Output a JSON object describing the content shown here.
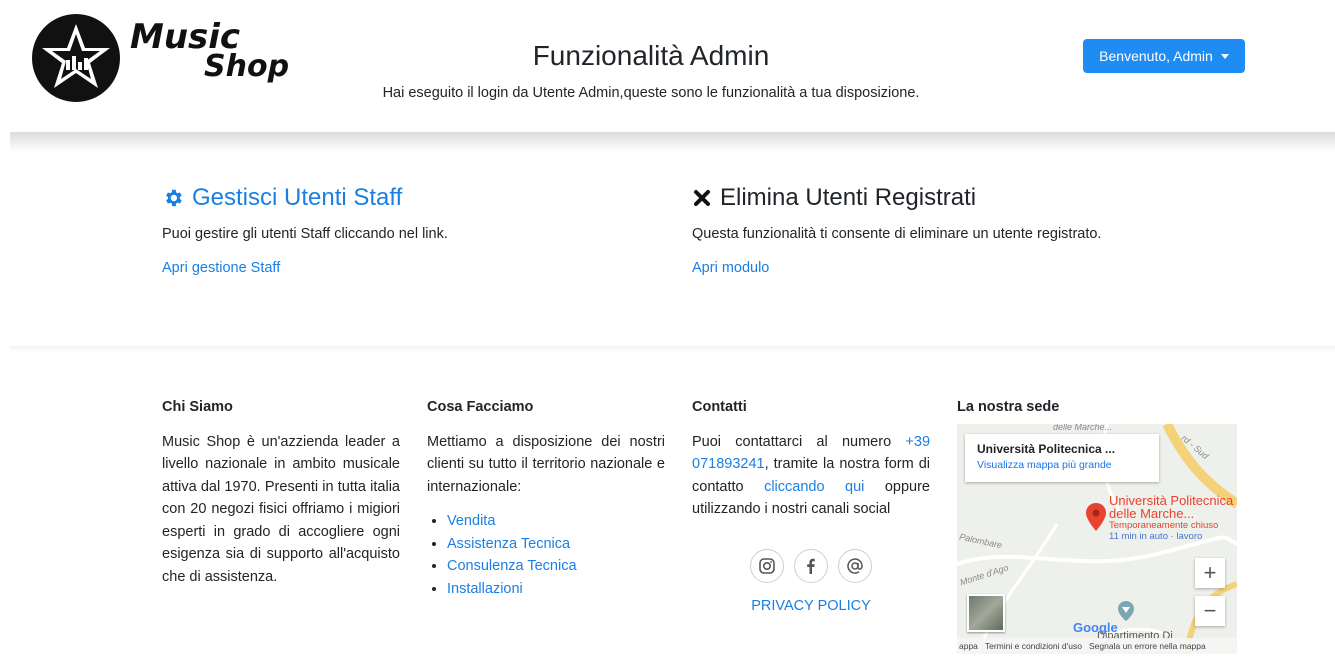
{
  "brand": {
    "line1": "Music",
    "line2": "Shop"
  },
  "header": {
    "title": "Funzionalità Admin",
    "subtitle": "Hai eseguito il login da Utente Admin,queste sono le funzionalità a tua disposizione.",
    "user_menu_label": "Benvenuto, Admin"
  },
  "features": [
    {
      "icon": "gear-icon",
      "title": "Gestisci Utenti Staff",
      "description": "Puoi gestire gli utenti Staff cliccando nel link.",
      "link": "Apri gestione Staff"
    },
    {
      "icon": "close-icon",
      "title": "Elimina Utenti Registrati",
      "description": "Questa funzionalità ti consente di eliminare un utente registrato.",
      "link": "Apri modulo"
    }
  ],
  "footer": {
    "about": {
      "title": "Chi Siamo",
      "text": "Music Shop è un'azzienda leader a livello nazionale in ambito musicale attiva dal 1970. Presenti in tutta italia con 20 negozi fisici offriamo i migiori esperti in grado di accogliere ogni esigenza sia di supporto all'acquisto che di assistenza."
    },
    "services": {
      "title": "Cosa Facciamo",
      "text": "Mettiamo a disposizione dei nostri clienti su tutto il territorio nazionale e internazionale:",
      "items": [
        "Vendita",
        "Assistenza Tecnica",
        "Consulenza Tecnica",
        "Installazioni"
      ]
    },
    "contacts": {
      "title": "Contatti",
      "text_1": "Puoi contattarci al numero",
      "phone": "+39 071893241",
      "text_2": ", tramite la nostra form di contatto",
      "link": "cliccando qui",
      "text_3": "oppure utilizzando i nostri canali social",
      "socials": [
        "instagram-icon",
        "facebook-icon",
        "email-icon"
      ],
      "privacy": "PRIVACY POLICY"
    },
    "location": {
      "title": "La nostra sede",
      "map": {
        "place_name": "Università Politecnica ...",
        "view_larger": "Visualizza mappa più grande",
        "pin_title": "Università Politecnica delle Marche...",
        "pin_status": "Temporaneamente chiuso",
        "pin_travel": "11 min in auto · lavoro",
        "street_1": "delle Marche...",
        "street_2": "Palombare",
        "street_3": "Monte d'Ago",
        "street_4": "rd - Sud",
        "bottom_label": "Dipartimento Di",
        "google": "Google",
        "footer_1": "appa",
        "footer_2": "Termini e condizioni d'uso",
        "footer_3": "Segnala un errore nella mappa",
        "zoom_in": "+",
        "zoom_out": "−"
      }
    }
  }
}
